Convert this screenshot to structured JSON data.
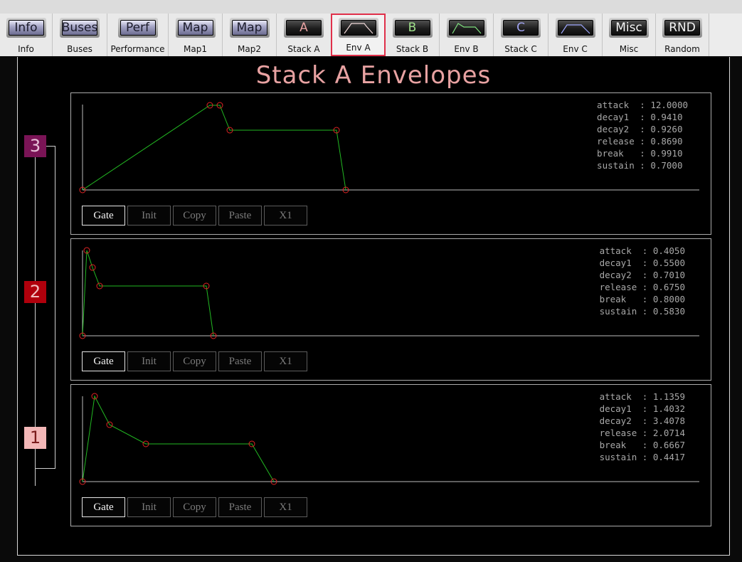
{
  "tabs": [
    {
      "button_text": "Info",
      "label": "Info",
      "button_style": "blue"
    },
    {
      "button_text": "Buses",
      "label": "Buses",
      "button_style": "blue"
    },
    {
      "button_text": "Perf",
      "label": "Performance",
      "button_style": "blue"
    },
    {
      "button_text": "Map",
      "label": "Map1",
      "button_style": "blue"
    },
    {
      "button_text": "Map",
      "label": "Map2",
      "button_style": "blue"
    },
    {
      "button_text": "A",
      "label": "Stack A",
      "button_style": "dark",
      "text_color": "#e8a2a2"
    },
    {
      "button_text": "",
      "label": "Env A",
      "button_style": "envelope",
      "selected": true
    },
    {
      "button_text": "B",
      "label": "Stack B",
      "button_style": "dark",
      "text_color": "#9fe08a"
    },
    {
      "button_text": "",
      "label": "Env B",
      "button_style": "envelope",
      "line_color": "#7fe07f"
    },
    {
      "button_text": "C",
      "label": "Stack C",
      "button_style": "dark",
      "text_color": "#a0a2f0"
    },
    {
      "button_text": "",
      "label": "Env C",
      "button_style": "envelope",
      "line_color": "#9fa8ff"
    },
    {
      "button_text": "Misc",
      "label": "Misc",
      "button_style": "dark",
      "text_color": "#f0f0f0"
    },
    {
      "button_text": "RND",
      "label": "Random",
      "button_style": "dark",
      "text_color": "#f0f0f0"
    }
  ],
  "page_title": "Stack A Envelopes",
  "layer_selectors": [
    "3",
    "2",
    "1"
  ],
  "panels": [
    {
      "layer": "3",
      "params": [
        {
          "name": "attack",
          "value": "12.0000"
        },
        {
          "name": "decay1",
          "value": "0.9410"
        },
        {
          "name": "decay2",
          "value": "0.9260"
        },
        {
          "name": "release",
          "value": "0.8690"
        },
        {
          "name": "break",
          "value": "0.9910"
        },
        {
          "name": "sustain",
          "value": "0.7000"
        }
      ],
      "buttons": [
        "Gate",
        "Init",
        "Copy",
        "Paste",
        "X1"
      ]
    },
    {
      "layer": "2",
      "params": [
        {
          "name": "attack",
          "value": "0.4050"
        },
        {
          "name": "decay1",
          "value": "0.5500"
        },
        {
          "name": "decay2",
          "value": "0.7010"
        },
        {
          "name": "release",
          "value": "0.6750"
        },
        {
          "name": "break",
          "value": "0.8000"
        },
        {
          "name": "sustain",
          "value": "0.5830"
        }
      ],
      "buttons": [
        "Gate",
        "Init",
        "Copy",
        "Paste",
        "X1"
      ]
    },
    {
      "layer": "1",
      "params": [
        {
          "name": "attack",
          "value": "1.1359"
        },
        {
          "name": "decay1",
          "value": "1.4032"
        },
        {
          "name": "decay2",
          "value": "3.4078"
        },
        {
          "name": "release",
          "value": "2.0714"
        },
        {
          "name": "break",
          "value": "0.6667"
        },
        {
          "name": "sustain",
          "value": "0.4417"
        }
      ],
      "buttons": [
        "Gate",
        "Init",
        "Copy",
        "Paste",
        "X1"
      ]
    }
  ],
  "colors": {
    "envelope_line": "#22b822",
    "envelope_node": "#e02424",
    "selected_tab_border": "#e0304a",
    "title": "#e8a2a2"
  }
}
